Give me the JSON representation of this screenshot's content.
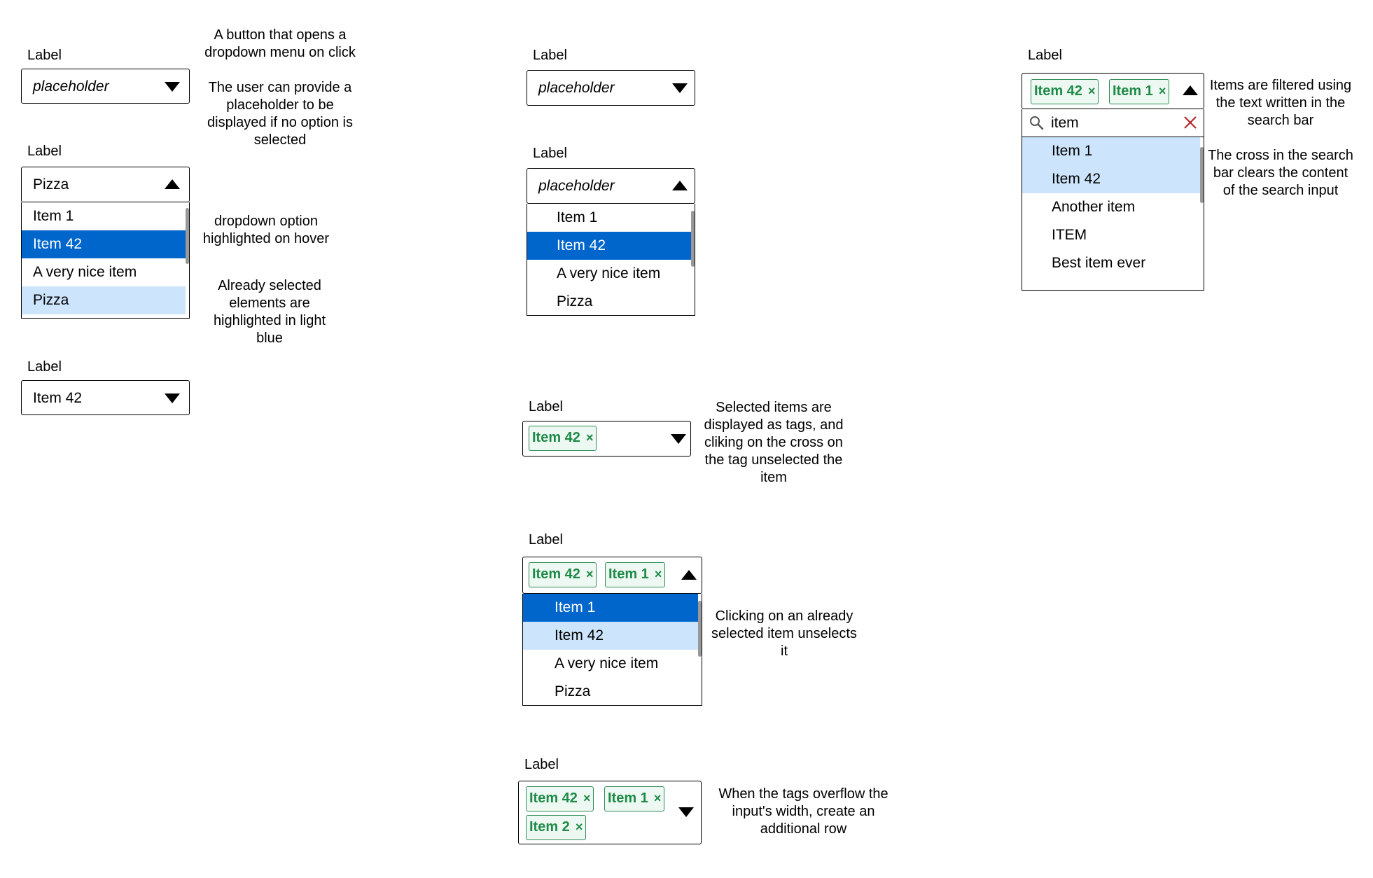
{
  "label": "Label",
  "placeholder": "placeholder",
  "notes": {
    "opens_menu": "A button that opens a dropdown menu on click",
    "placeholder_hint": "The user can provide a placeholder to be displayed if no option is selected",
    "hover": "dropdown option highlighted on hover",
    "already_selected": "Already selected elements are highlighted in light blue",
    "tags": "Selected items are displayed as tags, and cliking on the cross on the tag unselected the item",
    "unselect": "Clicking on an already selected item unselects it",
    "overflow": "When the tags overflow the input's width, create an additional row",
    "filter": "Items are filtered using the text written in the search bar",
    "clear": "The cross in the search bar clears the content of the search input"
  },
  "col1": {
    "open_value": "Pizza",
    "options": [
      "Item 1",
      "Item 42",
      "A very nice item",
      "Pizza"
    ],
    "closed_value": "Item 42"
  },
  "col2": {
    "options": [
      "Item 1",
      "Item 42",
      "A very nice item",
      "Pizza"
    ],
    "single_tag": "Item 42",
    "tags": [
      "Item 42",
      "Item 1"
    ],
    "overflow_tags": [
      "Item 42",
      "Item 1",
      "Item 2"
    ],
    "tag_remove": "×"
  },
  "col3": {
    "tags": [
      "Item 42",
      "Item 1"
    ],
    "search_value": "item",
    "options": [
      "Item 1",
      "Item 42",
      "Another item",
      "ITEM",
      "Best item ever"
    ]
  },
  "icons": {
    "arrow_down": "triangle-down-icon",
    "arrow_up": "triangle-up-icon",
    "search": "search-icon",
    "clear": "clear-icon"
  },
  "colors": {
    "hover": "#0066cc",
    "selected": "#cce5fc",
    "tag_border": "#2e8b57",
    "tag_text": "#1e8a48",
    "clear_icon": "#b22222"
  }
}
